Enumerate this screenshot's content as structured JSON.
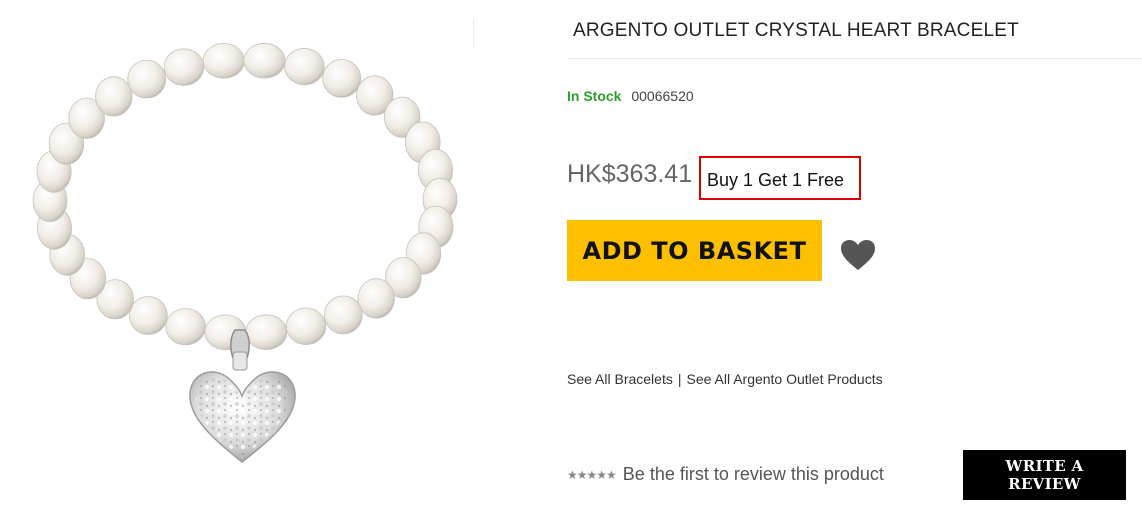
{
  "product": {
    "title": "ARGENTO OUTLET CRYSTAL HEART BRACELET",
    "stock_status": "In Stock",
    "sku": "00066520",
    "price": "HK$363.41",
    "promo": "Buy 1 Get 1 Free",
    "add_to_basket_label": "ADD TO BASKET",
    "wishlist_icon": "heart-icon",
    "image": "pearl-bracelet-heart-charm"
  },
  "links": {
    "see_all_bracelets": "See All Bracelets",
    "separator": "|",
    "see_all_brand": "See All Argento Outlet Products"
  },
  "reviews": {
    "stars": "★★★★★",
    "prompt": "Be the first to review this product",
    "write_review_label": "WRITE A REVIEW"
  },
  "colors": {
    "in_stock": "#2ea02e",
    "basket_button": "#fdc000",
    "promo_border": "#e00000",
    "review_button": "#000000"
  }
}
